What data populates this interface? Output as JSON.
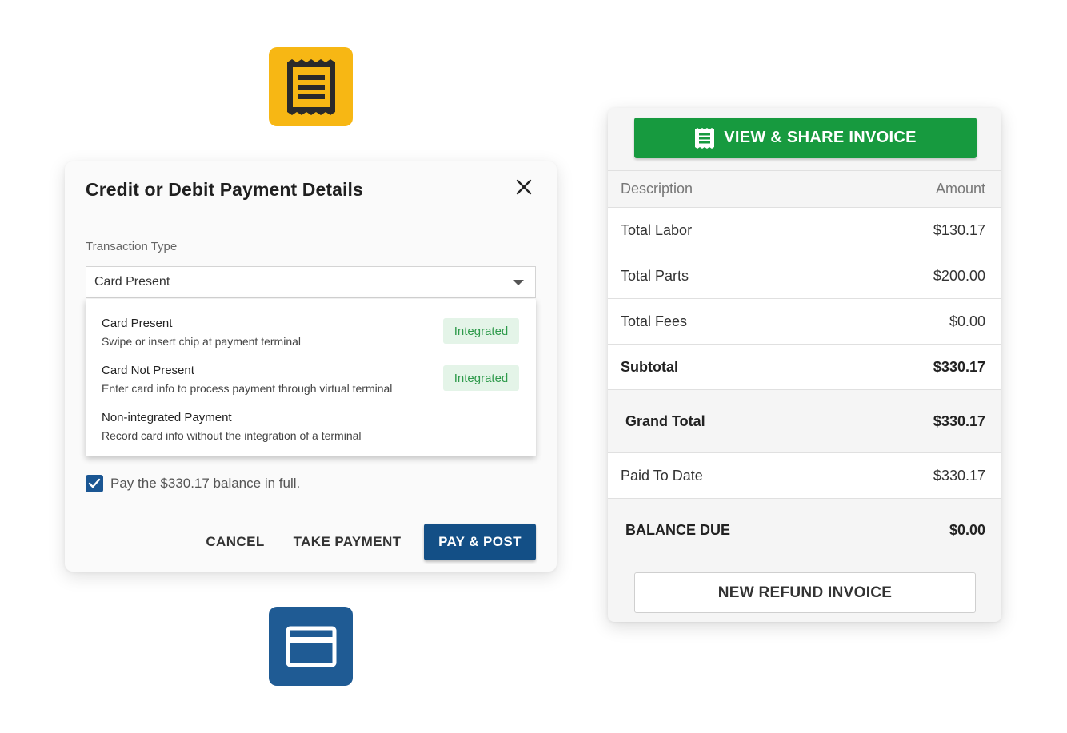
{
  "icons": {
    "receipt_tile": "receipt-icon",
    "card_tile": "credit-card-icon",
    "receipt_color": "#f7b714",
    "card_color": "#1f5b94"
  },
  "dialog": {
    "title": "Credit or Debit Payment Details",
    "close_icon": "close-icon",
    "transaction_type_label": "Transaction Type",
    "selected_value": "Card Present",
    "options": [
      {
        "title": "Card Present",
        "description": "Swipe or insert chip at payment terminal",
        "badge": "Integrated"
      },
      {
        "title": "Card Not Present",
        "description": "Enter card info to process payment through virtual terminal",
        "badge": "Integrated"
      },
      {
        "title": "Non-integrated Payment",
        "description": "Record card info without the integration of a terminal",
        "badge": ""
      }
    ],
    "pay_in_full_label": "Pay the $330.17 balance in full.",
    "pay_in_full_checked": true,
    "buttons": {
      "cancel": "CANCEL",
      "take_payment": "TAKE PAYMENT",
      "pay_post": "PAY & POST"
    },
    "colors": {
      "primary": "#134f86",
      "badge_bg": "#e4f4e8",
      "badge_text": "#2e9a4b"
    }
  },
  "invoice": {
    "view_share_label": "VIEW & SHARE INVOICE",
    "header": {
      "description": "Description",
      "amount": "Amount"
    },
    "rows": [
      {
        "label": "Total Labor",
        "amount": "$130.17"
      },
      {
        "label": "Total Parts",
        "amount": "$200.00"
      },
      {
        "label": "Total Fees",
        "amount": "$0.00"
      },
      {
        "label": "Subtotal",
        "amount": "$330.17"
      },
      {
        "label": "Grand Total",
        "amount": "$330.17"
      },
      {
        "label": "Paid To Date",
        "amount": "$330.17"
      },
      {
        "label": "BALANCE DUE",
        "amount": "$0.00"
      }
    ],
    "refund_label": "NEW REFUND INVOICE",
    "colors": {
      "view_button": "#179a3f"
    }
  }
}
